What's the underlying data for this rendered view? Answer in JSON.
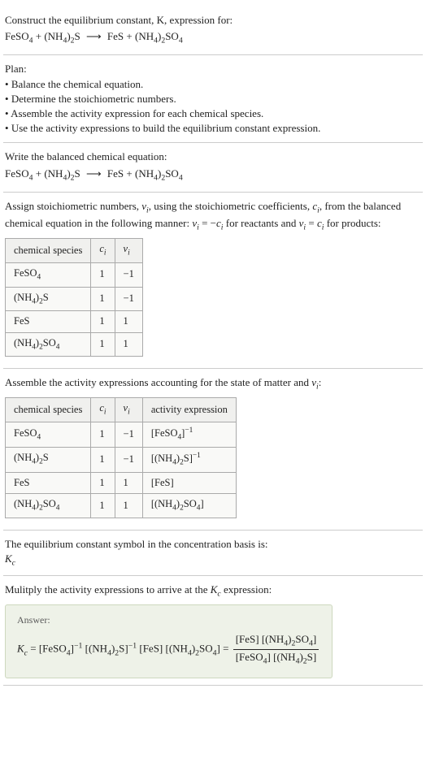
{
  "header": {
    "line1": "Construct the equilibrium constant, K, expression for:"
  },
  "reaction": {
    "r1": "FeSO",
    "r1s": "4",
    "plus1": " + ",
    "r2a": "(NH",
    "r2as": "4",
    "r2b": ")",
    "r2bs": "2",
    "r2c": "S",
    "arrow": "⟶",
    "p1": "FeS",
    "plus2": " + ",
    "p2a": "(NH",
    "p2as": "4",
    "p2b": ")",
    "p2bs": "2",
    "p2c": "SO",
    "p2cs": "4"
  },
  "plan": {
    "title": "Plan:",
    "b1": "Balance the chemical equation.",
    "b2": "Determine the stoichiometric numbers.",
    "b3": "Assemble the activity expression for each chemical species.",
    "b4": "Use the activity expressions to build the equilibrium constant expression."
  },
  "balanced_label": "Write the balanced chemical equation:",
  "stoich": {
    "intro_a": "Assign stoichiometric numbers, ",
    "nu": "ν",
    "nu_sub": "i",
    "intro_b": ", using the stoichiometric coefficients, ",
    "c": "c",
    "c_sub": "i",
    "intro_c": ", from the balanced chemical equation in the following manner: ",
    "eq1a": "ν",
    "eq1b": " = −",
    "eq1c": "c",
    "intro_d": " for reactants and ",
    "eq2a": "ν",
    "eq2b": " = ",
    "eq2c": "c",
    "intro_e": " for products:"
  },
  "table1": {
    "h1": "chemical species",
    "h2": "c",
    "h2s": "i",
    "h3": "ν",
    "h3s": "i",
    "r1c1a": "FeSO",
    "r1c1s": "4",
    "r1c2": "1",
    "r1c3": "−1",
    "r2c1a": "(NH",
    "r2c1s1": "4",
    "r2c1b": ")",
    "r2c1s2": "2",
    "r2c1c": "S",
    "r2c2": "1",
    "r2c3": "−1",
    "r3c1": "FeS",
    "r3c2": "1",
    "r3c3": "1",
    "r4c1a": "(NH",
    "r4c1s1": "4",
    "r4c1b": ")",
    "r4c1s2": "2",
    "r4c1c": "SO",
    "r4c1s3": "4",
    "r4c2": "1",
    "r4c3": "1"
  },
  "activity_intro": "Assemble the activity expressions accounting for the state of matter and ",
  "activity_intro_end": ":",
  "table2": {
    "h1": "chemical species",
    "h2": "c",
    "h2s": "i",
    "h3": "ν",
    "h3s": "i",
    "h4": "activity expression",
    "r1c4a": "[FeSO",
    "r1c4s": "4",
    "r1c4b": "]",
    "r1c4e": "−1",
    "r2c4a": "[(NH",
    "r2c4s1": "4",
    "r2c4b": ")",
    "r2c4s2": "2",
    "r2c4c": "S]",
    "r2c4e": "−1",
    "r3c4": "[FeS]",
    "r4c4a": "[(NH",
    "r4c4s1": "4",
    "r4c4b": ")",
    "r4c4s2": "2",
    "r4c4c": "SO",
    "r4c4s3": "4",
    "r4c4d": "]"
  },
  "kc_symbol": {
    "line": "The equilibrium constant symbol in the concentration basis is:",
    "sym": "K",
    "sub": "c"
  },
  "multiply": {
    "a": "Mulitply the activity expressions to arrive at the ",
    "k": "K",
    "ks": "c",
    "b": " expression:"
  },
  "answer": {
    "label": "Answer:",
    "Kc": "K",
    "Kcs": "c",
    "eq": " = ",
    "t1a": "[FeSO",
    "t1s": "4",
    "t1b": "]",
    "t1e": "−1",
    "sp": " ",
    "t2a": "[(NH",
    "t2s1": "4",
    "t2b": ")",
    "t2s2": "2",
    "t2c": "S]",
    "t2e": "−1",
    "t3": "[FeS]",
    "t4a": "[(NH",
    "t4s1": "4",
    "t4b": ")",
    "t4s2": "2",
    "t4c": "SO",
    "t4s3": "4",
    "t4d": "]",
    "eq2": " = ",
    "numA": "[FeS] [(NH",
    "numS1": "4",
    "numB": ")",
    "numS2": "2",
    "numC": "SO",
    "numS3": "4",
    "numD": "]",
    "denA": "[FeSO",
    "denS1": "4",
    "denB": "] [(NH",
    "denS2": "4",
    "denC": ")",
    "denS3": "2",
    "denD": "S]"
  },
  "chart_data": {
    "type": "table",
    "tables": [
      {
        "title": "stoichiometric numbers",
        "columns": [
          "chemical species",
          "c_i",
          "ν_i"
        ],
        "rows": [
          [
            "FeSO4",
            1,
            -1
          ],
          [
            "(NH4)2S",
            1,
            -1
          ],
          [
            "FeS",
            1,
            1
          ],
          [
            "(NH4)2SO4",
            1,
            1
          ]
        ]
      },
      {
        "title": "activity expressions",
        "columns": [
          "chemical species",
          "c_i",
          "ν_i",
          "activity expression"
        ],
        "rows": [
          [
            "FeSO4",
            1,
            -1,
            "[FeSO4]^-1"
          ],
          [
            "(NH4)2S",
            1,
            -1,
            "[(NH4)2S]^-1"
          ],
          [
            "FeS",
            1,
            1,
            "[FeS]"
          ],
          [
            "(NH4)2SO4",
            1,
            1,
            "[(NH4)2SO4]"
          ]
        ]
      }
    ]
  }
}
